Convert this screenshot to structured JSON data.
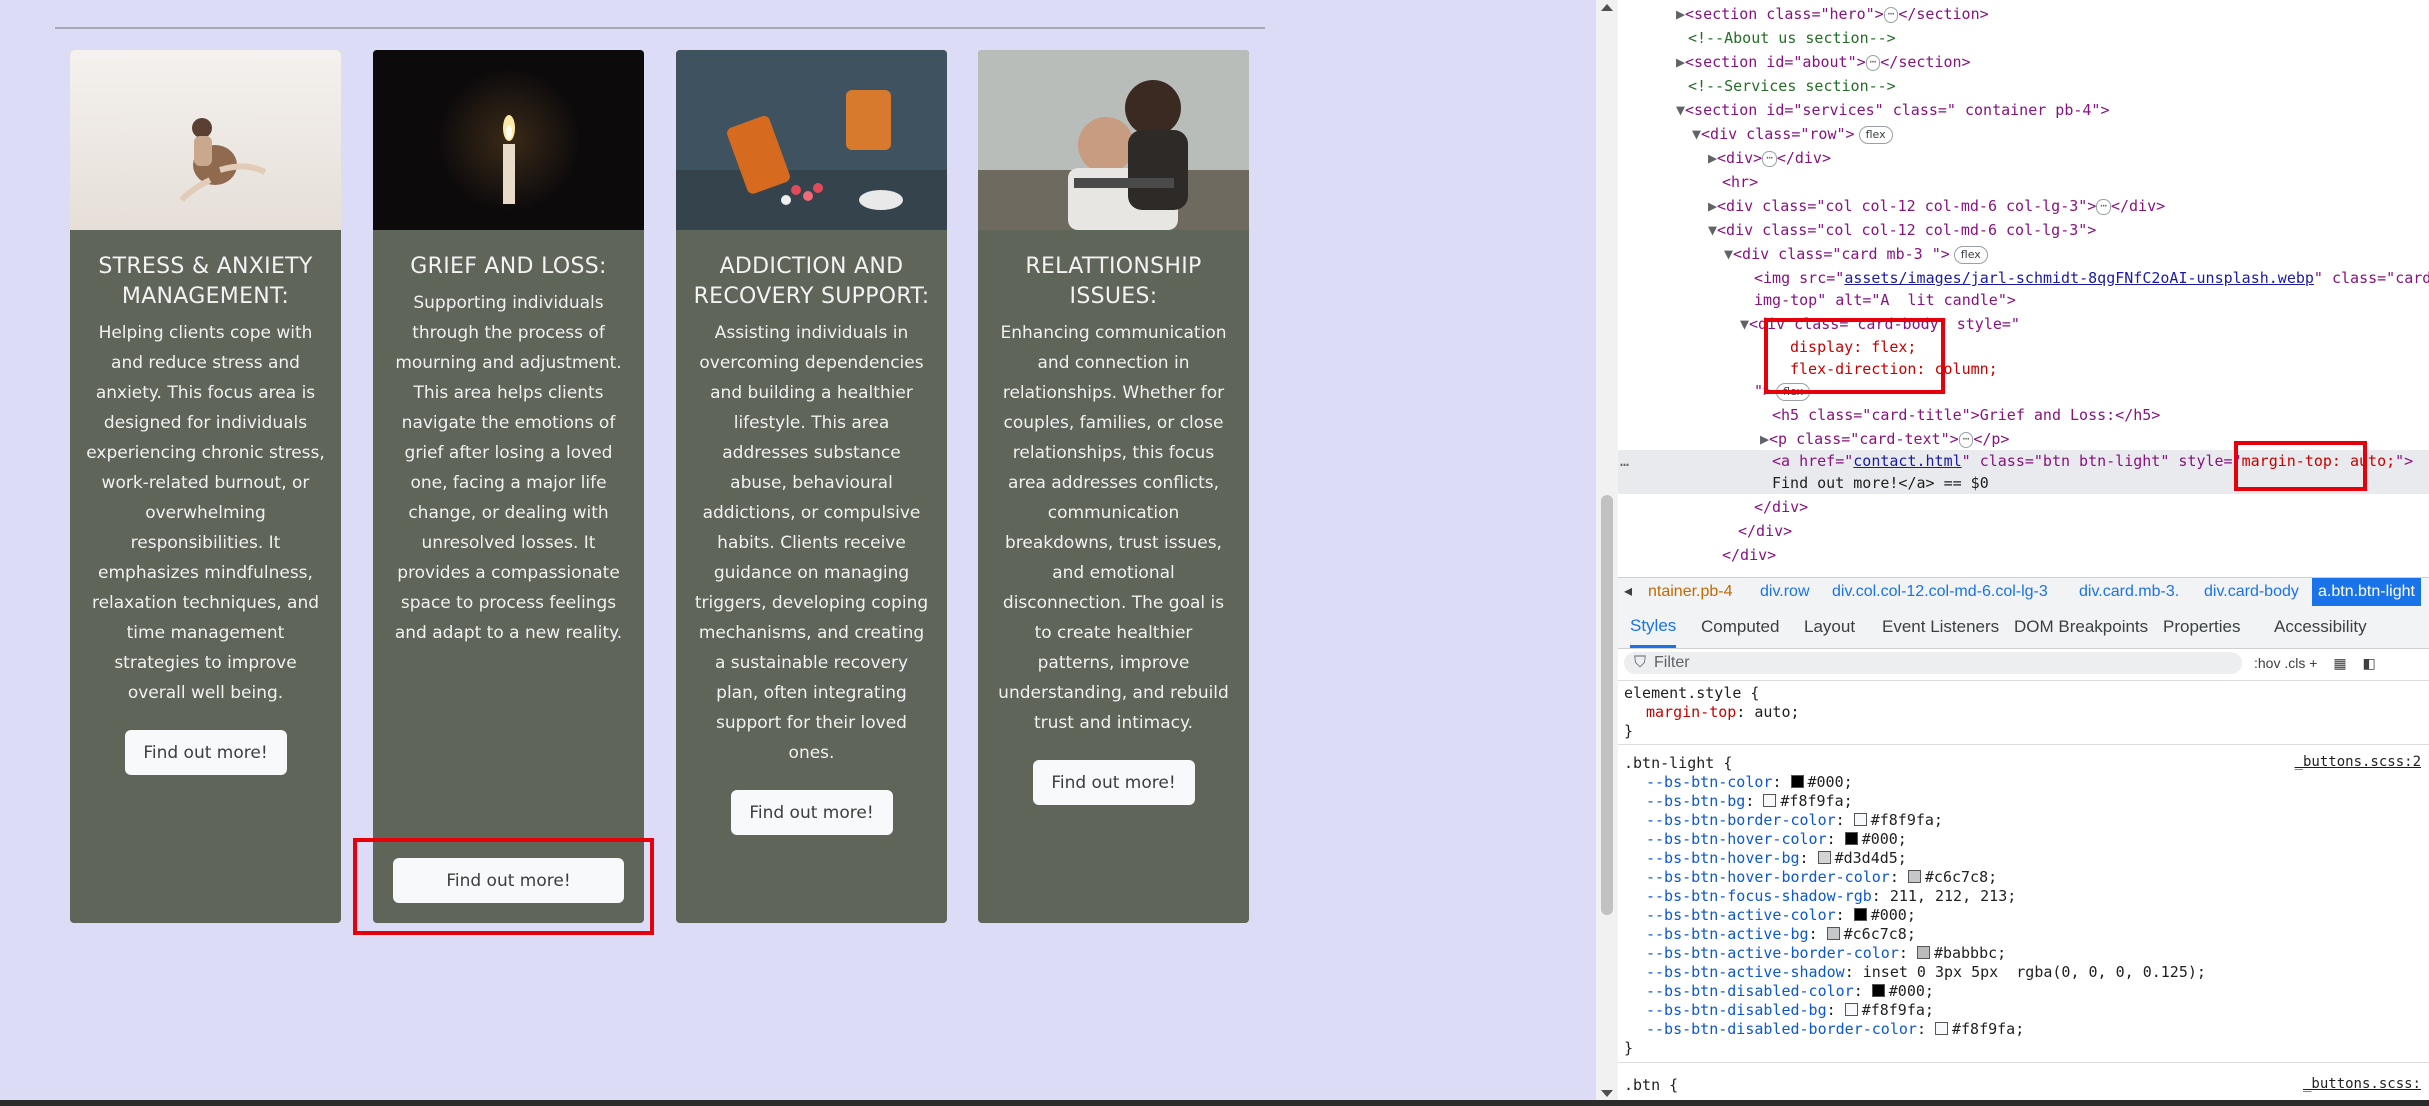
{
  "cards": [
    {
      "title": "STRESS & ANXIETY MANAGEMENT:",
      "text": "Helping clients cope with and reduce stress and anxiety. This focus area is designed for individuals experiencing chronic stress, work-related burnout, or overwhelming responsibilities. It emphasizes mindfulness, relaxation techniques, and time management strategies to improve overall well being.",
      "button": "Find out more!"
    },
    {
      "title": "GRIEF AND LOSS:",
      "text": "Supporting individuals through the process of mourning and adjustment. This area helps clients navigate the emotions of grief after losing a loved one, facing a major life change, or dealing with unresolved losses. It provides a compassionate space to process feelings and adapt to a new reality.",
      "button": "Find out more!"
    },
    {
      "title": "ADDICTION AND RECOVERY SUPPORT:",
      "text": "Assisting individuals in overcoming dependencies and building a healthier lifestyle. This area addresses substance abuse, behavioural addictions, or compulsive habits. Clients receive guidance on managing triggers, developing coping mechanisms, and creating a sustainable recovery plan, often integrating support for their loved ones.",
      "button": "Find out more!"
    },
    {
      "title": "RELATTIONSHIP ISSUES:",
      "text": "Enhancing communication and connection in relationships. Whether for couples, families, or close relationships, this focus area addresses conflicts, communication breakdowns, trust issues, and emotional disconnection. The goal is to create healthier patterns, improve understanding, and rebuild trust and intimacy.",
      "button": "Find out more!"
    }
  ],
  "devtools": {
    "elements": {
      "l1a": "<section class=\"hero\">",
      "l1b": "</section>",
      "l2": "<!--About us section-->",
      "l3a": "<section id=\"about\">",
      "l3b": "</section>",
      "l4": "<!--Services section-->",
      "l5": "<section id=\"services\" class=\" container pb-4\">",
      "l6": "<div class=\"row\">",
      "l6pill": "flex",
      "l7a": "<div>",
      "l7b": "</div>",
      "l8": "<hr>",
      "l9a": "<div class=\"col col-12 col-md-6 col-lg-3\">",
      "l9b": "</div>",
      "l10": "<div class=\"col col-12 col-md-6 col-lg-3\">",
      "l11": "<div class=\"card mb-3 \">",
      "l11pill": "flex",
      "l12a": "<img src=\"",
      "l12link": "assets/images/jarl-schmidt-8qgFNfC2oAI-unsplash.webp",
      "l12b": "\" class=\"card-",
      "l13": "img-top\" alt=\"A  lit candle\">",
      "l14": "<div class=\"card-body\" style=\"",
      "l15": "display: flex;",
      "l16": "flex-direction: column;",
      "l17a": "\">",
      "l17pill": "flex",
      "l18": "<h5 class=\"card-title\">Grief and Loss:</h5>",
      "l19a": "<p class=\"card-text\">",
      "l19b": "</p>",
      "l20a": "<a href=\"",
      "l20link": "contact.html",
      "l20b": "\" class=\"btn btn-light\" style=\"",
      "l20c": "margin-top: auto;",
      "l20d": "\">",
      "l21": "Find out more!</a> == $0",
      "l22": "</div>",
      "l23": "</div>",
      "l24": "</div>",
      "dots": "…",
      "ell": "⋯"
    },
    "breadcrumbs": [
      "ntainer.pb-4",
      "div.row",
      "div.col.col-12.col-md-6.col-lg-3",
      "div.card.mb-3.",
      "div.card-body",
      "a.btn.btn-light"
    ],
    "tabs": [
      "Styles",
      "Computed",
      "Layout",
      "Event Listeners",
      "DOM Breakpoints",
      "Properties",
      "Accessibility"
    ],
    "filter_placeholder": "Filter",
    "filter_tools": ":hov  .cls  +",
    "styles": {
      "element_style": "element.style {",
      "el_prop": "margin-top",
      "el_val": "auto;",
      "close": "}",
      "btn_light_sel": ".btn-light {",
      "btn_light_src": "_buttons.scss:2",
      "vars": [
        {
          "name": "--bs-btn-color",
          "swatch": "#000000",
          "value": "#000;"
        },
        {
          "name": "--bs-btn-bg",
          "swatch": "#f8f9fa",
          "value": "#f8f9fa;"
        },
        {
          "name": "--bs-btn-border-color",
          "swatch": "#f8f9fa",
          "value": "#f8f9fa;"
        },
        {
          "name": "--bs-btn-hover-color",
          "swatch": "#000000",
          "value": "#000;"
        },
        {
          "name": "--bs-btn-hover-bg",
          "swatch": "#d3d4d5",
          "value": "#d3d4d5;"
        },
        {
          "name": "--bs-btn-hover-border-color",
          "swatch": "#c6c7c8",
          "value": "#c6c7c8;"
        },
        {
          "name": "--bs-btn-focus-shadow-rgb",
          "swatch": "",
          "value": "211, 212, 213;"
        },
        {
          "name": "--bs-btn-active-color",
          "swatch": "#000000",
          "value": "#000;"
        },
        {
          "name": "--bs-btn-active-bg",
          "swatch": "#c6c7c8",
          "value": "#c6c7c8;"
        },
        {
          "name": "--bs-btn-active-border-color",
          "swatch": "#babbbc",
          "value": "#babbbc;"
        },
        {
          "name": "--bs-btn-active-shadow",
          "swatch": "",
          "value": "inset 0 3px 5px  rgba(0, 0, 0, 0.125);"
        },
        {
          "name": "--bs-btn-disabled-color",
          "swatch": "#000000",
          "value": "#000;"
        },
        {
          "name": "--bs-btn-disabled-bg",
          "swatch": "#f8f9fa",
          "value": "#f8f9fa;"
        },
        {
          "name": "--bs-btn-disabled-border-color",
          "swatch": "#f8f9fa",
          "value": "#f8f9fa;"
        }
      ],
      "btn_sel": ".btn {",
      "btn_src": "_buttons.scss:"
    }
  }
}
